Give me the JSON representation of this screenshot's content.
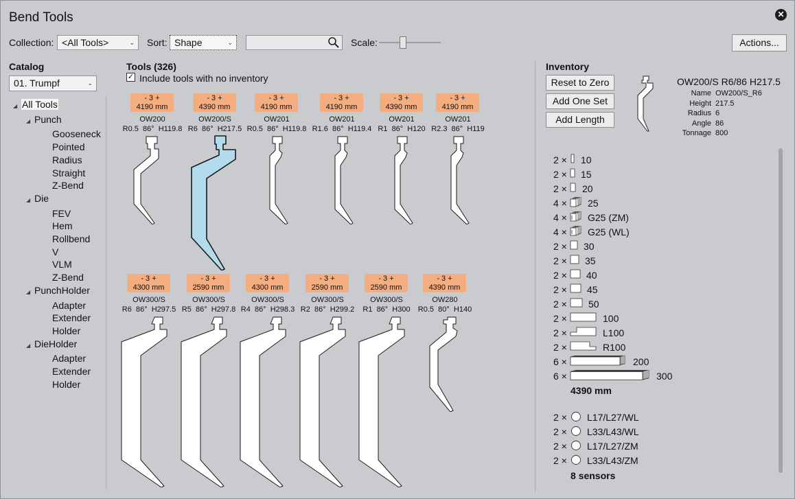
{
  "window": {
    "title": "Bend Tools"
  },
  "toolbar": {
    "collection_label": "Collection:",
    "collection_value": "<All Tools>",
    "sort_label": "Sort:",
    "sort_value": "Shape",
    "search_value": "",
    "scale_label": "Scale:",
    "actions_label": "Actions..."
  },
  "catalog": {
    "header": "Catalog",
    "selected": "01. Trumpf",
    "tree": [
      {
        "label": "All Tools",
        "level": 0,
        "expander": true
      },
      {
        "label": "Punch",
        "level": 1,
        "expander": true
      },
      {
        "label": "Gooseneck",
        "level": 2
      },
      {
        "label": "Pointed",
        "level": 2
      },
      {
        "label": "Radius",
        "level": 2
      },
      {
        "label": "Straight",
        "level": 2
      },
      {
        "label": "Z-Bend",
        "level": 2
      },
      {
        "label": "Die",
        "level": 1,
        "expander": true
      },
      {
        "label": "FEV",
        "level": 2
      },
      {
        "label": "Hem",
        "level": 2
      },
      {
        "label": "Rollbend",
        "level": 2
      },
      {
        "label": "V",
        "level": 2
      },
      {
        "label": "VLM",
        "level": 2
      },
      {
        "label": "Z-Bend",
        "level": 2
      },
      {
        "label": "PunchHolder",
        "level": 1,
        "expander": true
      },
      {
        "label": "Adapter",
        "level": 2
      },
      {
        "label": "Extender",
        "level": 2
      },
      {
        "label": "Holder",
        "level": 2
      },
      {
        "label": "DieHolder",
        "level": 1,
        "expander": true
      },
      {
        "label": "Adapter",
        "level": 2
      },
      {
        "label": "Extender",
        "level": 2
      },
      {
        "label": "Holder",
        "level": 2
      }
    ]
  },
  "tools": {
    "header": "Tools (326)",
    "include_label": "Include tools with no inventory",
    "include_checked": true,
    "items": [
      {
        "chip_top": "- 3 +",
        "chip_len": "4190 mm",
        "name": "OW200",
        "specs": "R0.5  86°  H119.8",
        "shape": "goose",
        "selected": false
      },
      {
        "chip_top": "- 3 +",
        "chip_len": "4390 mm",
        "name": "OW200/S",
        "specs": "R6  86°  H217.5",
        "shape": "goose-tall",
        "selected": true
      },
      {
        "chip_top": "- 3 +",
        "chip_len": "4190 mm",
        "name": "OW201",
        "specs": "R0.5  86°  H119.8",
        "shape": "straight",
        "selected": false
      },
      {
        "chip_top": "- 3 +",
        "chip_len": "4190 mm",
        "name": "OW201",
        "specs": "R1.6  86°  H119.4",
        "shape": "straight",
        "selected": false
      },
      {
        "chip_top": "- 3 +",
        "chip_len": "4390 mm",
        "name": "OW201",
        "specs": "R1  86°  H120",
        "shape": "straight",
        "selected": false
      },
      {
        "chip_top": "- 3 +",
        "chip_len": "4190 mm",
        "name": "OW201",
        "specs": "R2.3  86°  H119",
        "shape": "straight",
        "selected": false
      },
      {
        "chip_top": "- 3 +",
        "chip_len": "4300 mm",
        "name": "OW300/S",
        "specs": "R6  86°  H297.5",
        "shape": "big",
        "selected": false
      },
      {
        "chip_top": "- 3 +",
        "chip_len": "2590 mm",
        "name": "OW300/S",
        "specs": "R5  86°  H297.8",
        "shape": "big",
        "selected": false
      },
      {
        "chip_top": "- 3 +",
        "chip_len": "4300 mm",
        "name": "OW300/S",
        "specs": "R4  86°  H298.3",
        "shape": "big",
        "selected": false
      },
      {
        "chip_top": "- 3 +",
        "chip_len": "2590 mm",
        "name": "OW300/S",
        "specs": "R2  86°  H299.2",
        "shape": "big",
        "selected": false
      },
      {
        "chip_top": "- 3 +",
        "chip_len": "2590 mm",
        "name": "OW300/S",
        "specs": "R1  86°  H300",
        "shape": "big",
        "selected": false
      },
      {
        "chip_top": "- 3 +",
        "chip_len": "4390 mm",
        "name": "OW280",
        "specs": "R0.5  80°  H140",
        "shape": "small",
        "selected": false
      }
    ]
  },
  "inventory": {
    "header": "Inventory",
    "reset_label": "Reset to Zero",
    "add_set_label": "Add One Set",
    "add_length_label": "Add Length",
    "detail": {
      "title": "OW200/S R6/86 H217.5",
      "rows": [
        {
          "key": "Name",
          "value": "OW200/S_R6"
        },
        {
          "key": "Height",
          "value": "217.5"
        },
        {
          "key": "Radius",
          "value": "6"
        },
        {
          "key": "Angle",
          "value": "86"
        },
        {
          "key": "Tonnage",
          "value": "800"
        }
      ]
    },
    "segments": [
      {
        "count": "2 ×",
        "name": "10",
        "kind": "s10"
      },
      {
        "count": "2 ×",
        "name": "15",
        "kind": "s15"
      },
      {
        "count": "2 ×",
        "name": "20",
        "kind": "s20"
      },
      {
        "count": "4 ×",
        "name": "25",
        "kind": "stack"
      },
      {
        "count": "4 ×",
        "name": "G25 (ZM)",
        "kind": "stackg"
      },
      {
        "count": "4 ×",
        "name": "G25 (WL)",
        "kind": "stackg"
      },
      {
        "count": "2 ×",
        "name": "30",
        "kind": "s30"
      },
      {
        "count": "2 ×",
        "name": "35",
        "kind": "s35"
      },
      {
        "count": "2 ×",
        "name": "40",
        "kind": "s40"
      },
      {
        "count": "2 ×",
        "name": "45",
        "kind": "s45"
      },
      {
        "count": "2 ×",
        "name": "50",
        "kind": "s50"
      },
      {
        "count": "2 ×",
        "name": "100",
        "kind": "s100"
      },
      {
        "count": "2 ×",
        "name": "L100",
        "kind": "l100"
      },
      {
        "count": "2 ×",
        "name": "R100",
        "kind": "r100"
      },
      {
        "count": "6 ×",
        "name": "200",
        "kind": "s200"
      },
      {
        "count": "6 ×",
        "name": "300",
        "kind": "s300"
      }
    ],
    "total_length": "4390 mm",
    "sensors": [
      {
        "count": "2 ×",
        "name": "L17/L27/WL"
      },
      {
        "count": "2 ×",
        "name": "L33/L43/WL"
      },
      {
        "count": "2 ×",
        "name": "L17/L27/ZM"
      },
      {
        "count": "2 ×",
        "name": "L33/L43/ZM"
      }
    ],
    "sensor_total": "8 sensors"
  }
}
